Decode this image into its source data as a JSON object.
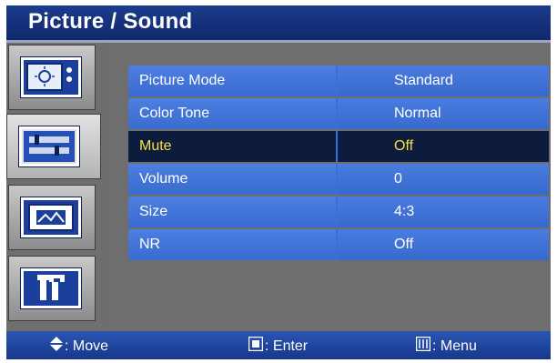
{
  "header": {
    "title": "Picture / Sound"
  },
  "sidebar": {
    "items": [
      {
        "name": "picture",
        "icon": "tv-picture-icon"
      },
      {
        "name": "sound",
        "icon": "sound-settings-icon",
        "active": true
      },
      {
        "name": "screen",
        "icon": "screen-image-icon"
      },
      {
        "name": "setup",
        "icon": "tools-icon"
      }
    ]
  },
  "menu": {
    "rows": [
      {
        "label": "Picture Mode",
        "value": "Standard"
      },
      {
        "label": "Color Tone",
        "value": "Normal"
      },
      {
        "label": "Mute",
        "value": "Off",
        "selected": true
      },
      {
        "label": "Volume",
        "value": "0"
      },
      {
        "label": "Size",
        "value": "4:3"
      },
      {
        "label": "NR",
        "value": "Off"
      }
    ]
  },
  "footer": {
    "move": ": Move",
    "enter": ": Enter",
    "menu": ": Menu"
  },
  "colors": {
    "title_bg": "#11286b",
    "row_bg": "#3d6fd3",
    "selected_bg": "#0d1b3c",
    "selected_text": "#f5e342",
    "panel_bg": "#6d6d6d"
  }
}
